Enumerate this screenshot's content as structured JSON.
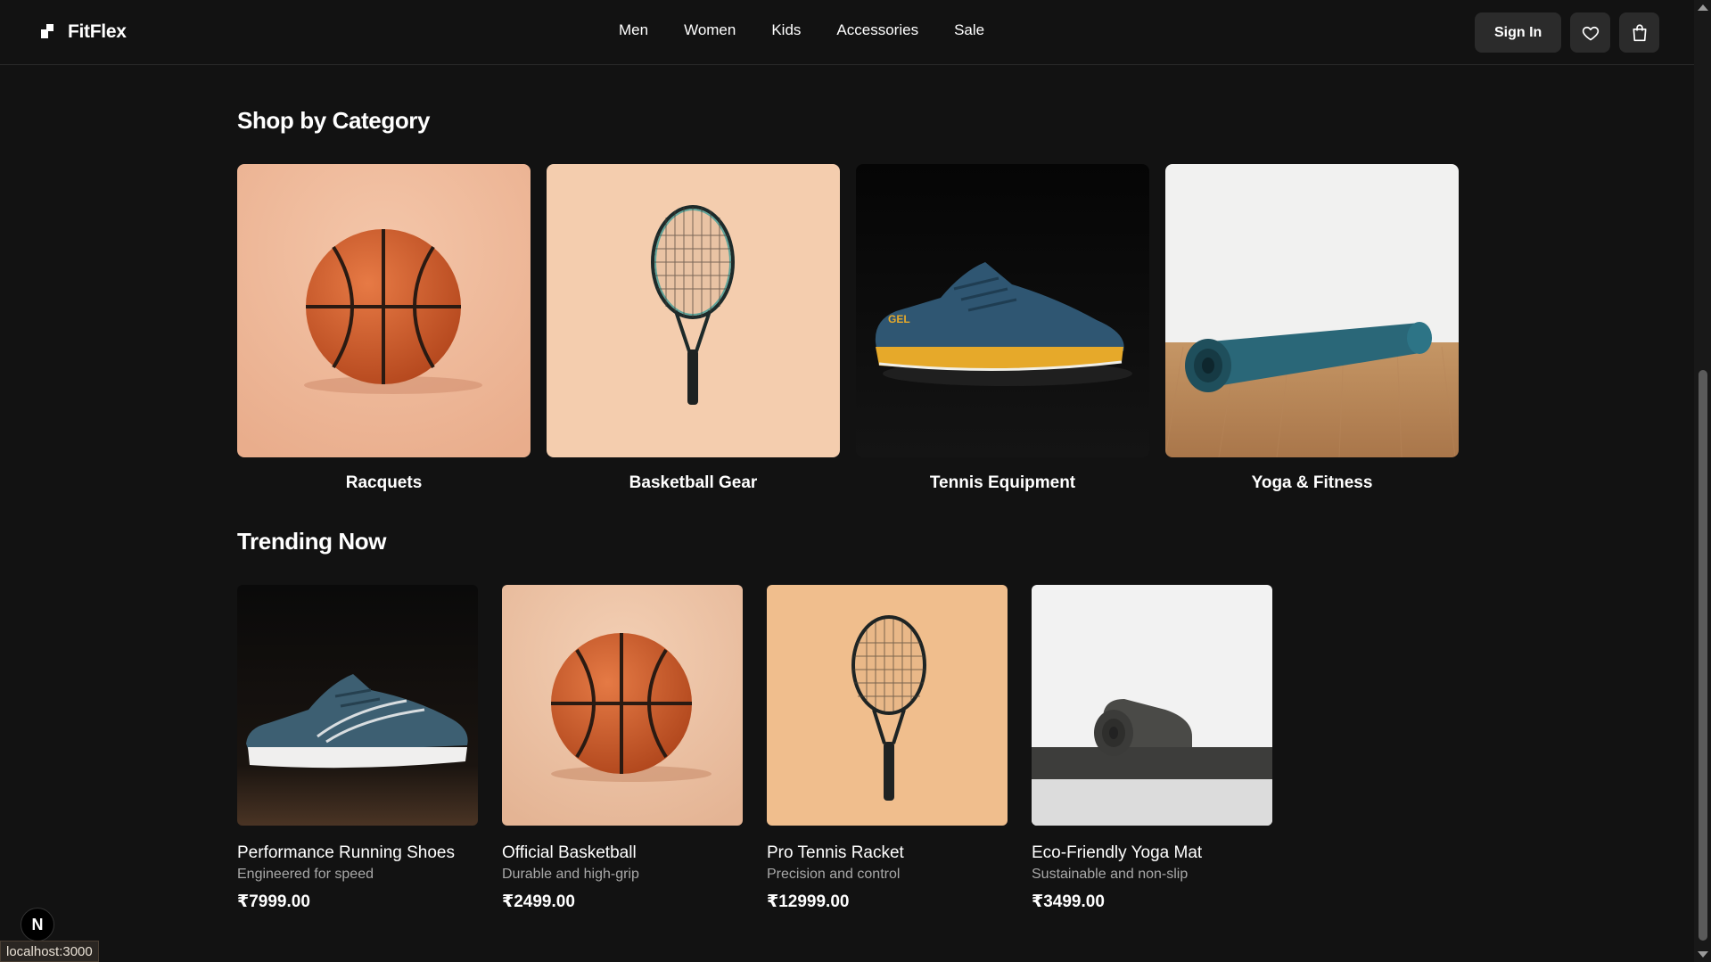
{
  "brand": {
    "name": "FitFlex"
  },
  "nav": [
    {
      "label": "Men"
    },
    {
      "label": "Women"
    },
    {
      "label": "Kids"
    },
    {
      "label": "Accessories"
    },
    {
      "label": "Sale"
    }
  ],
  "header": {
    "signin_label": "Sign In",
    "wishlist_icon": "heart-icon",
    "cart_icon": "shopping-bag-icon"
  },
  "categories": {
    "title": "Shop by Category",
    "items": [
      {
        "label": "Racquets",
        "image": "basketball"
      },
      {
        "label": "Basketball Gear",
        "image": "tennis-racket"
      },
      {
        "label": "Tennis Equipment",
        "image": "running-shoe"
      },
      {
        "label": "Yoga & Fitness",
        "image": "yoga-mat"
      }
    ]
  },
  "trending": {
    "title": "Trending Now",
    "items": [
      {
        "name": "Performance Running Shoes",
        "desc": "Engineered for speed",
        "price": "₹7999.00"
      },
      {
        "name": "Official Basketball",
        "desc": "Durable and high-grip",
        "price": "₹2499.00"
      },
      {
        "name": "Pro Tennis Racket",
        "desc": "Precision and control",
        "price": "₹12999.00"
      },
      {
        "name": "Eco-Friendly Yoga Mat",
        "desc": "Sustainable and non-slip",
        "price": "₹3499.00"
      }
    ]
  },
  "dev_badge": "N",
  "status_url": "localhost:3000",
  "colors": {
    "background": "#121212",
    "button_bg": "#2b2b2b",
    "muted_text": "#a8a8a8"
  }
}
